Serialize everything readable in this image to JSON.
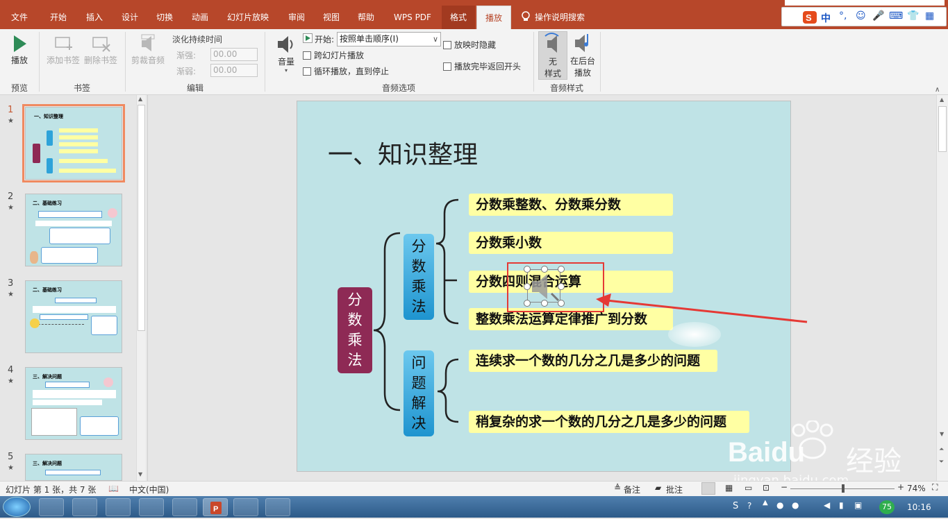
{
  "tabs": [
    "文件",
    "开始",
    "插入",
    "设计",
    "切换",
    "动画",
    "幻灯片放映",
    "审阅",
    "视图",
    "帮助",
    "WPS PDF",
    "格式",
    "播放"
  ],
  "tell_me": "操作说明搜索",
  "ime": {
    "label": "中"
  },
  "ribbon": {
    "preview": {
      "play": "播放",
      "group": "预览"
    },
    "bookmarks": {
      "add": "添加书签",
      "remove": "删除书签",
      "group": "书签"
    },
    "edit": {
      "trim": "剪裁音频",
      "fade_title": "淡化持续时间",
      "fade_in": "渐强:",
      "fade_out": "渐弱:",
      "fade_in_value": "00.00",
      "fade_out_value": "00.00",
      "group": "编辑"
    },
    "audio_options": {
      "volume": "音量",
      "start_label": "开始:",
      "start_value": "按照单击顺序(I)",
      "across_slides": "跨幻灯片播放",
      "loop": "循环播放，直到停止",
      "hide": "放映时隐藏",
      "rewind": "播放完毕返回开头",
      "group": "音频选项"
    },
    "audio_styles": {
      "no_style_line1": "无",
      "no_style_line2": "样式",
      "bg_line1": "在后台",
      "bg_line2": "播放",
      "group": "音频样式"
    }
  },
  "slides": [
    {
      "num": "1",
      "title": "一、知识整理"
    },
    {
      "num": "2",
      "title": "二、基础练习"
    },
    {
      "num": "3",
      "title": "二、基础练习"
    },
    {
      "num": "4",
      "title": "三、解决问题"
    },
    {
      "num": "5",
      "title": "三、解决问题"
    }
  ],
  "main_slide": {
    "title": "一、知识整理",
    "root": [
      "分",
      "数",
      "乘",
      "法"
    ],
    "branch1": [
      "分",
      "数",
      "乘",
      "法"
    ],
    "branch2": [
      "问",
      "题",
      "解",
      "决"
    ],
    "items1": [
      "分数乘整数、分数乘分数",
      "分数乘小数",
      "分数四则混合运算",
      "整数乘法运算定律推广到分数"
    ],
    "items2": [
      "连续求一个数的几分之几是多少的问题",
      "稍复杂的求一个数的几分之几是多少的问题"
    ]
  },
  "watermark": {
    "brand": "Baidu",
    "cn": "经验",
    "url": "jingyan.baidu.com"
  },
  "status": {
    "slide_info": "幻灯片 第 1 张，共 7 张",
    "lang": "中文(中国)",
    "notes": "备注",
    "comments": "批注",
    "zoom": "74%"
  },
  "taskbar": {
    "tray_badge": "75",
    "time": "10:16"
  }
}
